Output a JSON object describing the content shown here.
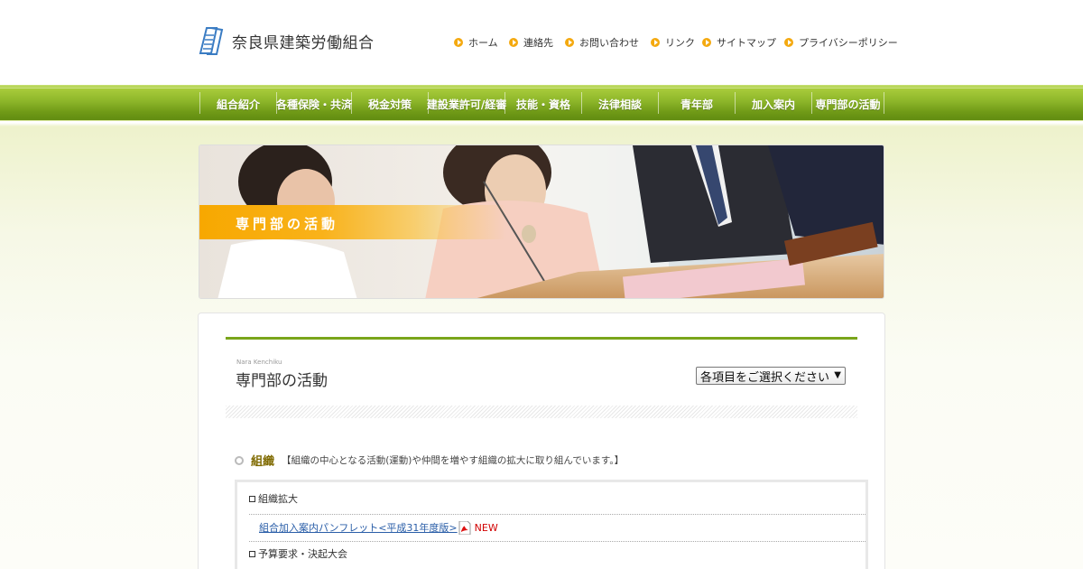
{
  "header": {
    "site_name": "奈良県建築労働組合",
    "util_links": [
      "ホーム",
      "連絡先",
      "お問い合わせ",
      "リンク",
      "サイトマップ",
      "プライバシーポリシー"
    ]
  },
  "main_nav": [
    "組合紹介",
    "各種保険・共済",
    "税金対策",
    "建設業許可/経審",
    "技能・資格",
    "法律相談",
    "青年部",
    "加入案内",
    "専門部の活動"
  ],
  "hero": {
    "title": "専門部の活動"
  },
  "page": {
    "subtitle_en": "Nara Kenchiku",
    "title": "専門部の活動",
    "select_label": "各項目をご選択ください"
  },
  "section": {
    "title": "組織",
    "description": "【組織の中心となる活動(運動)や仲間を増やす組織の拡大に取り組んでいます。】",
    "items": [
      {
        "label": "組織拡大"
      },
      {
        "link": "組合加入案内パンフレット<平成31年度版>",
        "badge": "NEW"
      },
      {
        "label": "予算要求・決起大会"
      }
    ]
  },
  "colors": {
    "nav_green": "#7aa51b",
    "accent_orange": "#f7a800",
    "new_red": "#d10000"
  }
}
